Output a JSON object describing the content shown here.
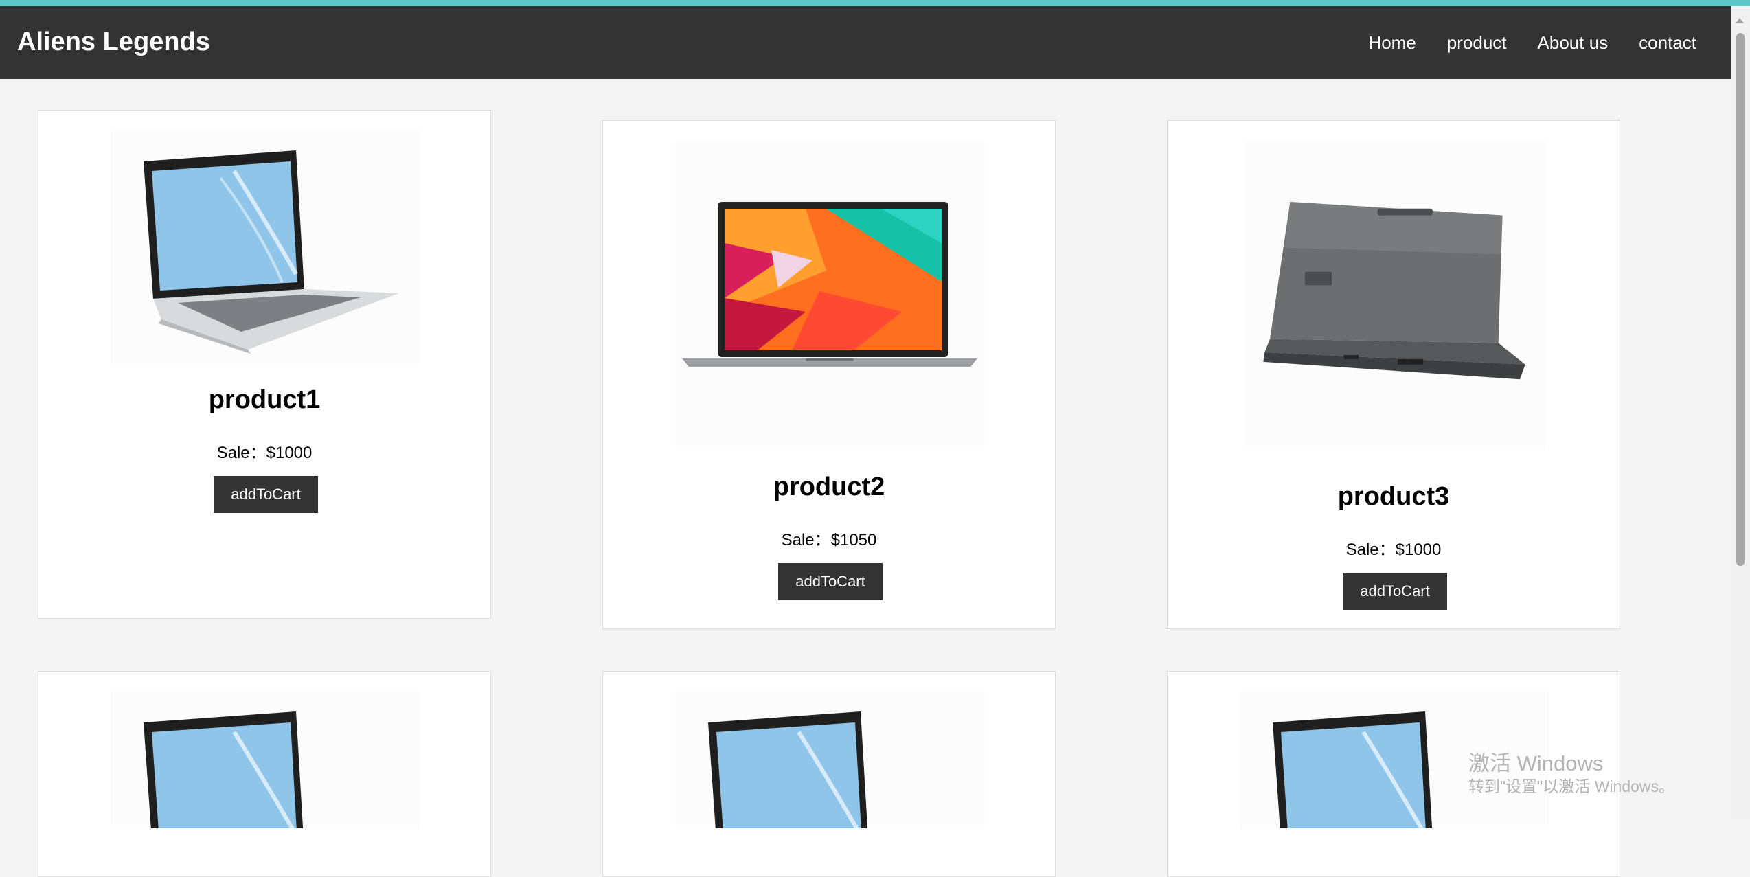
{
  "header": {
    "brand": "Aliens Legends",
    "nav": [
      "Home",
      "product",
      "About us",
      "contact"
    ]
  },
  "products": [
    {
      "name": "product1",
      "price": "Sale：$1000",
      "button": "addToCart",
      "image": "silver-laptop-image"
    },
    {
      "name": "product2",
      "price": "Sale：$1050",
      "button": "addToCart",
      "image": "colorful-screen-laptop-image"
    },
    {
      "name": "product3",
      "price": "Sale：$1000",
      "button": "addToCart",
      "image": "gray-laptop-back-image"
    }
  ],
  "row2": [
    {
      "image": "silver-laptop-image"
    },
    {
      "image": "silver-laptop-image"
    },
    {
      "image": "silver-laptop-image"
    }
  ],
  "watermark": {
    "line1": "激活 Windows",
    "line2": "转到\"设置\"以激活 Windows。"
  },
  "colors": {
    "accent_strip": "#5cc8c8",
    "navbar": "#333333",
    "button": "#333333",
    "page_bg": "#f4f4f4"
  }
}
